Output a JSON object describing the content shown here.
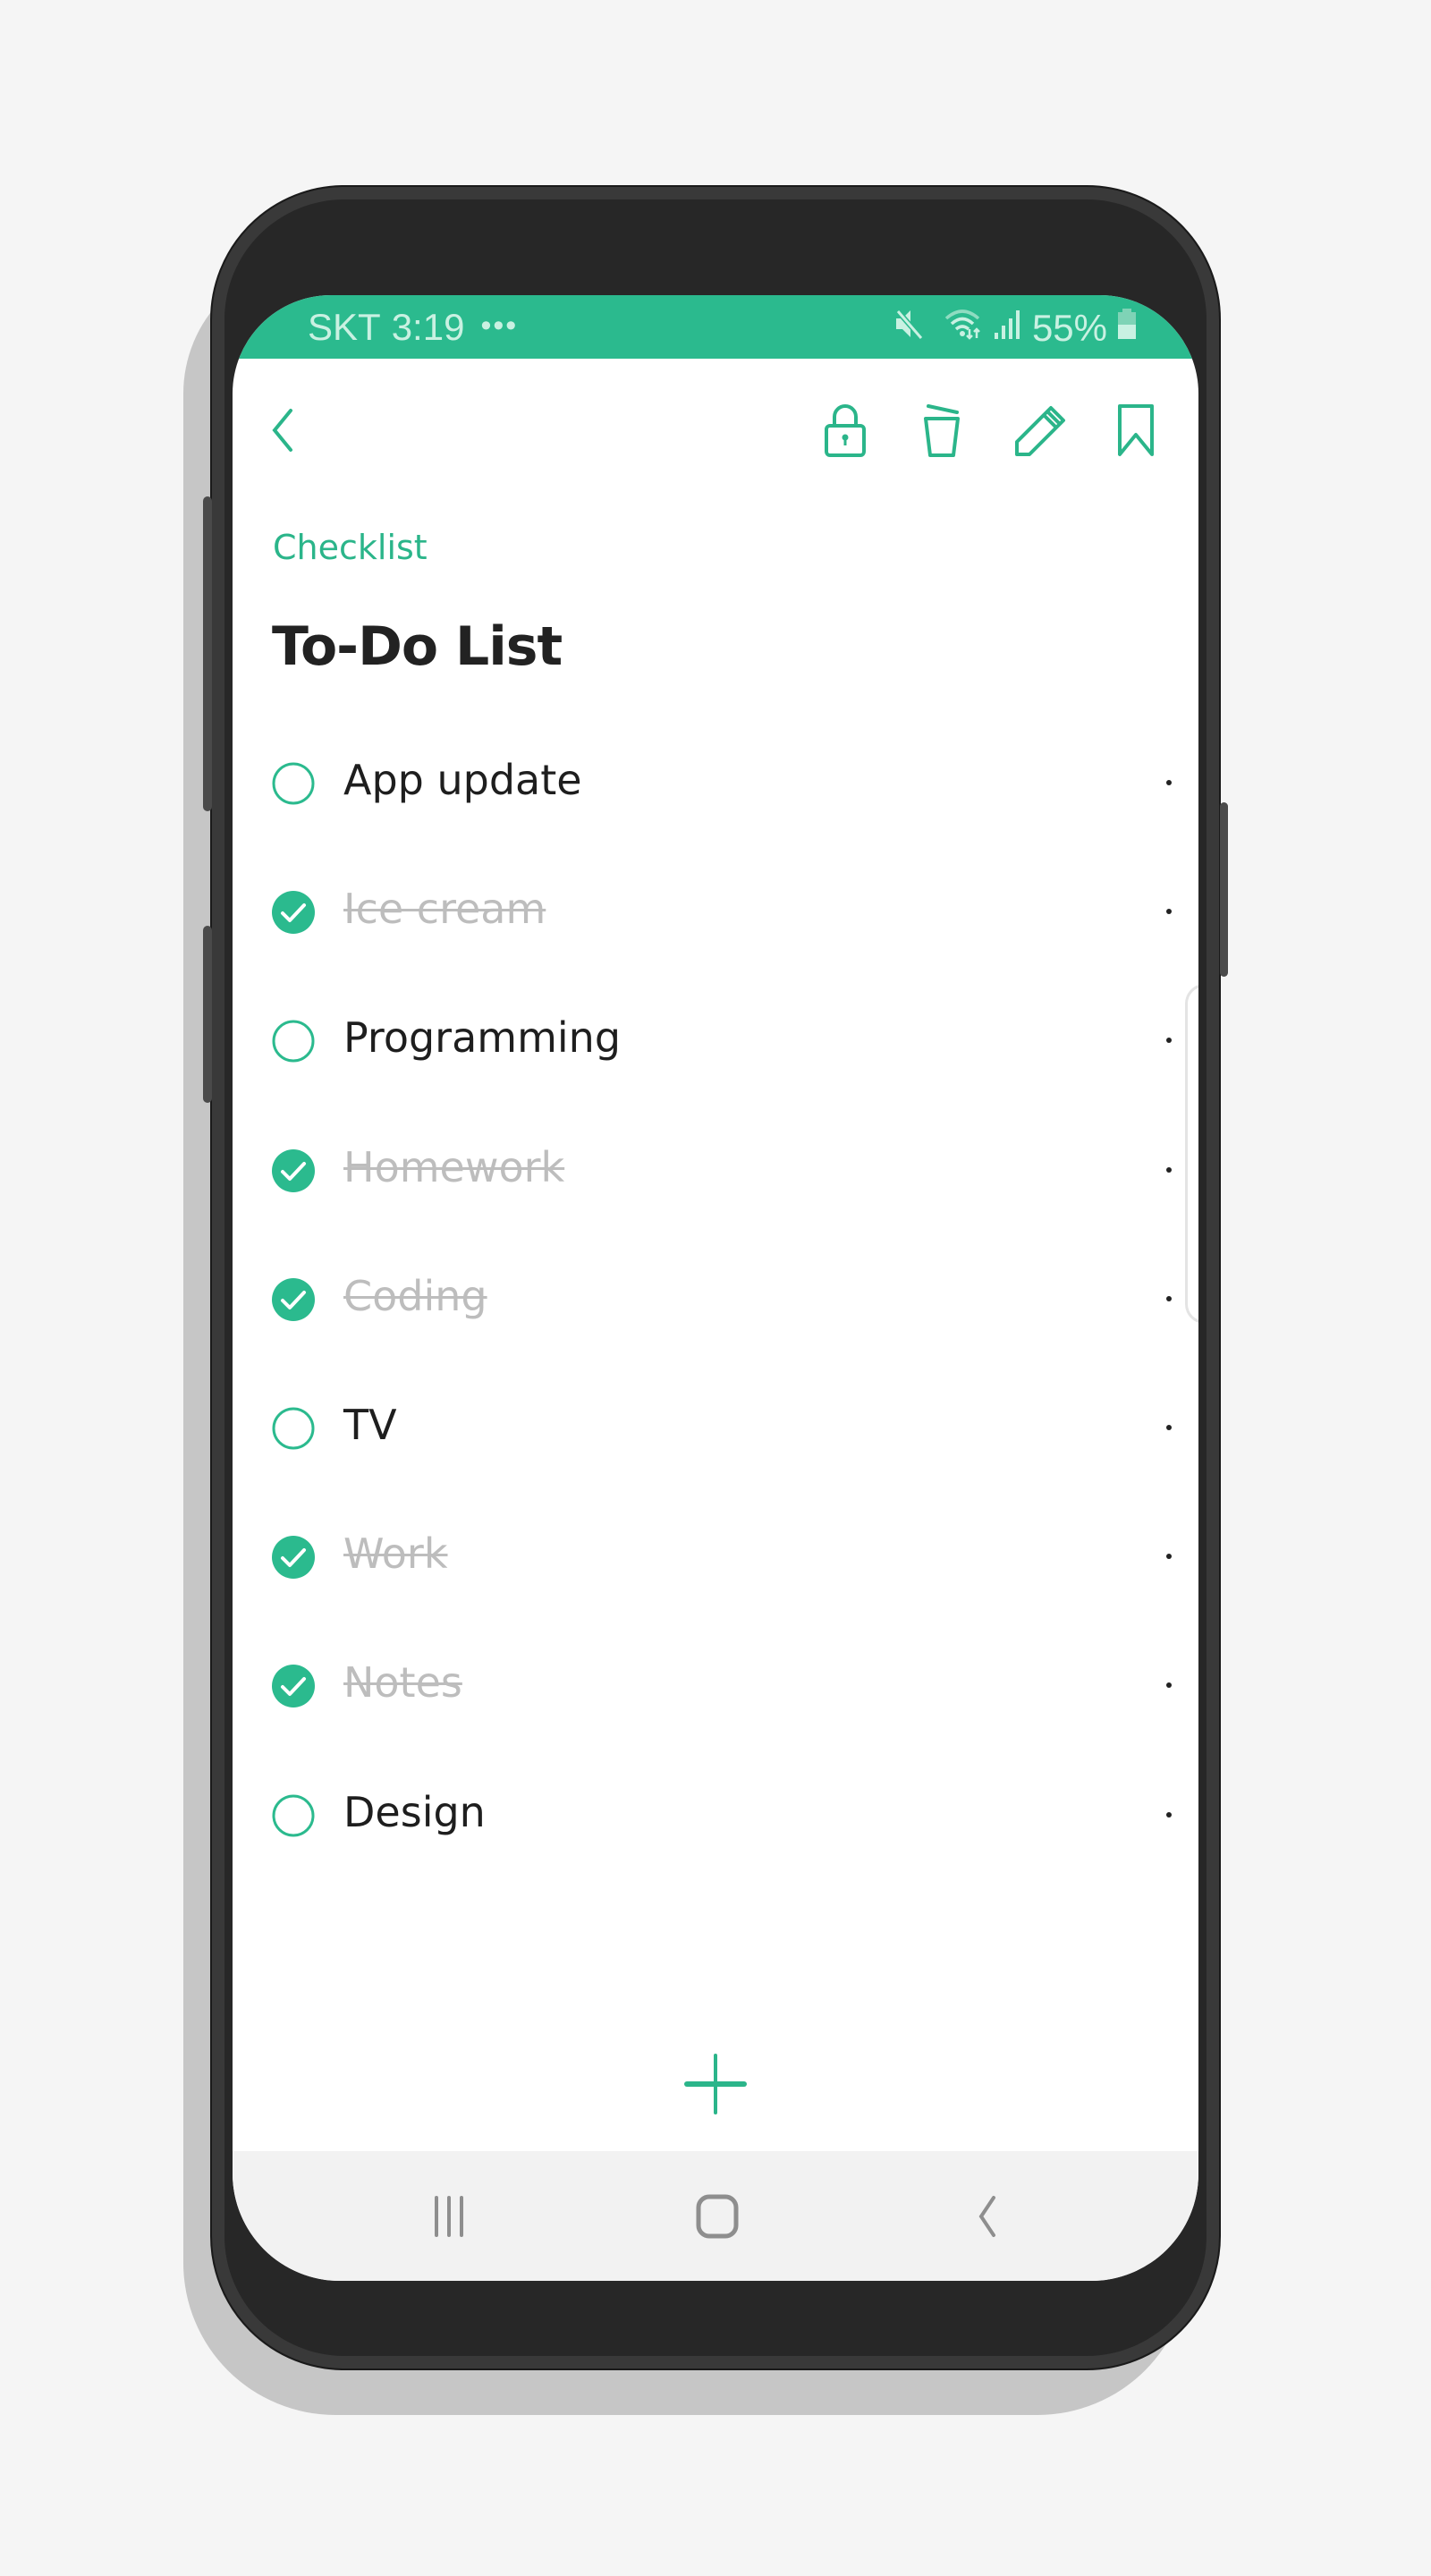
{
  "status_bar": {
    "carrier": "SKT",
    "time": "3:19",
    "more_notifications": "•••",
    "battery_percent": "55%",
    "icons": [
      "mute-icon",
      "wifi-icon",
      "signal-icon",
      "battery-icon"
    ]
  },
  "toolbar": {
    "back": "back-icon",
    "actions": [
      "lock-icon",
      "delete-icon",
      "edit-icon",
      "bookmark-icon"
    ]
  },
  "note": {
    "category": "Checklist",
    "title": "To-Do List",
    "items": [
      {
        "label": "App update",
        "checked": false
      },
      {
        "label": "Ice cream",
        "checked": true
      },
      {
        "label": "Programming",
        "checked": false
      },
      {
        "label": "Homework",
        "checked": true
      },
      {
        "label": "Coding",
        "checked": true
      },
      {
        "label": "TV",
        "checked": false
      },
      {
        "label": "Work",
        "checked": true
      },
      {
        "label": "Notes",
        "checked": true
      },
      {
        "label": "Design",
        "checked": false
      }
    ]
  },
  "add_item": "plus-icon",
  "navbar": [
    "recent-apps-icon",
    "home-icon",
    "back-icon"
  ],
  "colors": {
    "accent": "#2bba8e",
    "status_text": "#c9f1e2",
    "done_text": "#bdbdbd",
    "text": "#1e1e1e",
    "frame": "#272727",
    "navbar_bg": "#f2f2f2"
  }
}
